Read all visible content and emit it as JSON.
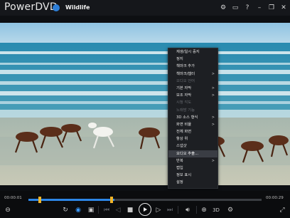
{
  "app": {
    "name": "PowerDVD",
    "file_title": "Wildlife"
  },
  "titlebar_icons": [
    "gear-icon",
    "tv-mode-icon",
    "help-icon",
    "minimize-icon",
    "restore-icon",
    "close-icon"
  ],
  "titlebar_glyphs": {
    "settings": "⚙",
    "tv": "▭",
    "help": "?",
    "minimize": "–",
    "restore": "❐",
    "close": "✕"
  },
  "context_menu": {
    "items": [
      {
        "label": "재생/일시 중지",
        "disabled": false,
        "submenu": false
      },
      {
        "label": "정지",
        "disabled": false,
        "submenu": false
      },
      {
        "label": "책마크 추가",
        "disabled": false,
        "submenu": false
      },
      {
        "label": "책마크/챕터",
        "disabled": false,
        "submenu": true
      },
      {
        "label": "오디오 언어",
        "disabled": true,
        "submenu": false
      },
      {
        "label": "기본 자막",
        "disabled": false,
        "submenu": true
      },
      {
        "label": "보조 자막",
        "disabled": false,
        "submenu": true
      },
      {
        "label": "시청 각도",
        "disabled": true,
        "submenu": false
      },
      {
        "label": "노래방 기능",
        "disabled": true,
        "submenu": false
      },
      {
        "label": "3D 소스 형식",
        "disabled": false,
        "submenu": true
      },
      {
        "label": "화면 비율",
        "disabled": false,
        "submenu": true
      },
      {
        "label": "전체 화면",
        "disabled": false,
        "submenu": false
      },
      {
        "label": "항상 위",
        "disabled": false,
        "submenu": false
      },
      {
        "label": "스냅샷",
        "disabled": false,
        "submenu": false
      },
      {
        "label": "오디오 추출...",
        "disabled": false,
        "submenu": false,
        "highlighted": true
      },
      {
        "label": "반복",
        "disabled": false,
        "submenu": true
      },
      {
        "label": "캡입",
        "disabled": false,
        "submenu": false
      },
      {
        "label": "정보 표시",
        "disabled": false,
        "submenu": false
      },
      {
        "label": "설정",
        "disabled": false,
        "submenu": false
      }
    ]
  },
  "playback": {
    "elapsed": "00:00:01",
    "total": "00:00:29",
    "progress_fraction": 0.37,
    "threed_label": "3D"
  },
  "colors": {
    "accent": "#2d86e6",
    "marker": "#f0b429",
    "menu_bg": "#1d1f23"
  }
}
